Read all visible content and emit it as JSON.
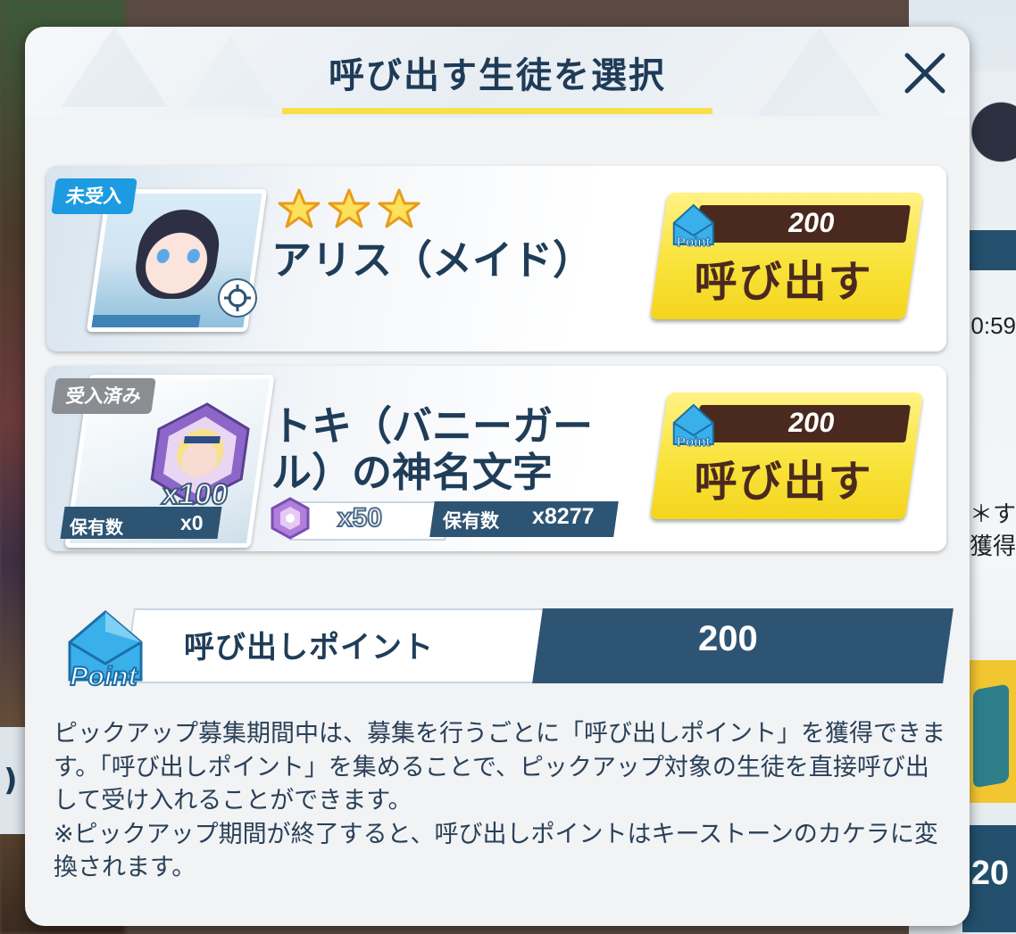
{
  "dialog": {
    "title": "呼び出す生徒を選択"
  },
  "students": [
    {
      "status_badge": "未受入",
      "name": "アリス（メイド）",
      "stars": 3,
      "cost": "200",
      "call_label": "呼び出す"
    },
    {
      "status_badge": "受入済み",
      "name": "トキ（バニーガール）の神名文字",
      "shard_count": "x100",
      "owned_label": "保有数",
      "owned_value": "x0",
      "eleph_cost": "x50",
      "eleph_owned_label": "保有数",
      "eleph_owned_value": "x8277",
      "cost": "200",
      "call_label": "呼び出す"
    }
  ],
  "call_points": {
    "label": "呼び出しポイント",
    "value": "200",
    "icon_text": "Point"
  },
  "description": {
    "line1": "ピックアップ募集期間中は、募集を行うごとに「呼び出しポイント」を獲得できます。「呼び出しポイント」を集めることで、ピックアップ対象の生徒を直接呼び出して受け入れることができます。",
    "line2": "※ピックアップ期間が終了すると、呼び出しポイントはキーストーンのカケラに変換されます。"
  },
  "background": {
    "right_text_1": "0:59",
    "right_text_2": "＊す",
    "right_text_3": "獲得",
    "right_text_4": "20",
    "left_text": ")"
  },
  "colors": {
    "accent_yellow": "#f9e33b",
    "title_navy": "#1e3b57",
    "dark_panel": "#2e5474",
    "badge_blue": "#1c9be0",
    "badge_gray": "#8a8e92",
    "cost_brown": "#4a2a1e"
  }
}
